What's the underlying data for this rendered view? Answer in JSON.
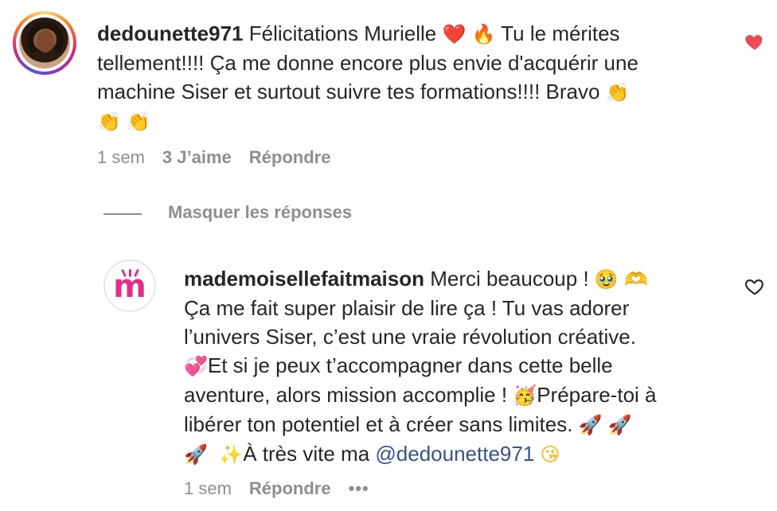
{
  "comment": {
    "username": "dedounette971",
    "text_part1": " Félicitations Murielle ",
    "text_part2": " Tu le mérites",
    "line2": "tellement!!!! Ça me donne encore plus envie d'acquérir une",
    "line3": "machine Siser et surtout suivre tes formations!!!! Bravo ",
    "emoji_heart": "❤️",
    "emoji_fire": "🔥",
    "emoji_clap": "👏",
    "time": "1 sem",
    "likes": "3 J’aime",
    "reply_label": "Répondre",
    "liked": true,
    "like_color": "#ed4956"
  },
  "replies_toggle": {
    "label": "Masquer les réponses"
  },
  "reply": {
    "username": "mademoisellefaitmaison",
    "line1_text": " Merci beaucoup ! ",
    "line2": "Ça me fait super plaisir de lire ça ! Tu vas adorer",
    "line3": "l’univers Siser, c’est une vraie révolution créative.",
    "line4_text": "Et si je peux t’accompagner dans cette belle",
    "line5_text": "aventure, alors mission accomplie ! ",
    "line5_text2": "Prépare-toi à",
    "line6_text": "libérer ton potentiel et à créer sans limites. ",
    "line7_text": "À très vite ma ",
    "mention": "@dedounette971",
    "emoji_pleading": "🥹",
    "emoji_heart_hands": "🫶",
    "emoji_two_hearts": "💞",
    "emoji_party": "🥳",
    "emoji_rocket": "🚀",
    "emoji_sparkles": "✨",
    "emoji_kiss": "😘",
    "time": "1 sem",
    "reply_label": "Répondre",
    "more_label": "•••",
    "liked": false
  },
  "colors": {
    "text": "#262626",
    "secondary": "#8e8e8e",
    "mention": "#385185",
    "brand": "#e42d8a"
  }
}
